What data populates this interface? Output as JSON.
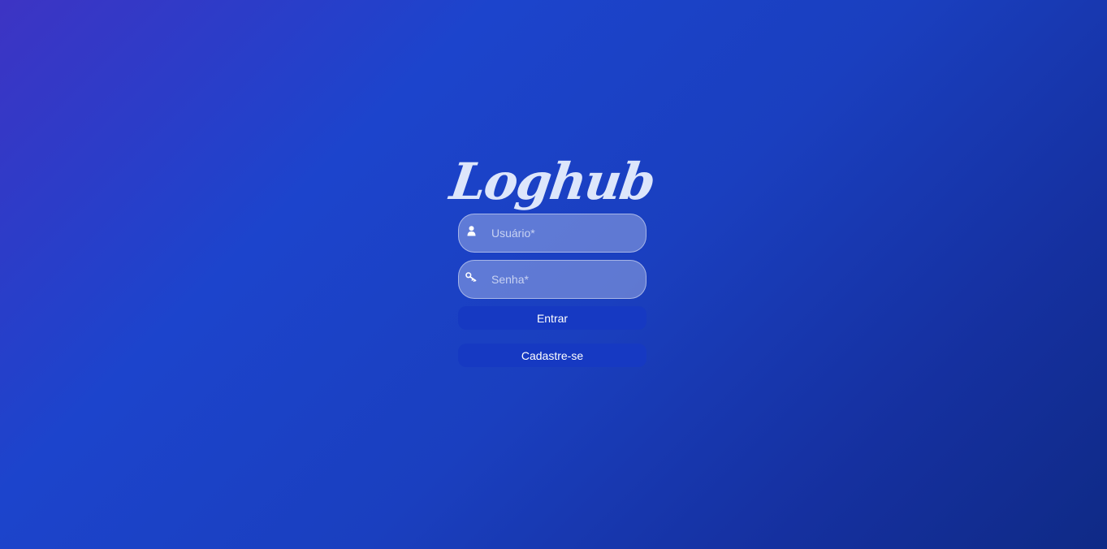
{
  "brand": {
    "logo_text": "Loghub"
  },
  "form": {
    "username": {
      "placeholder": "Usuário*",
      "value": "",
      "icon": "user-icon"
    },
    "password": {
      "placeholder": "Senha*",
      "value": "",
      "icon": "key-icon"
    },
    "login_label": "Entrar",
    "signup_label": "Cadastre-se"
  },
  "colors": {
    "background_start": "#3d34c4",
    "background_end": "#0f2a86",
    "button": "#1639c2",
    "logo": "#dde6fb"
  }
}
